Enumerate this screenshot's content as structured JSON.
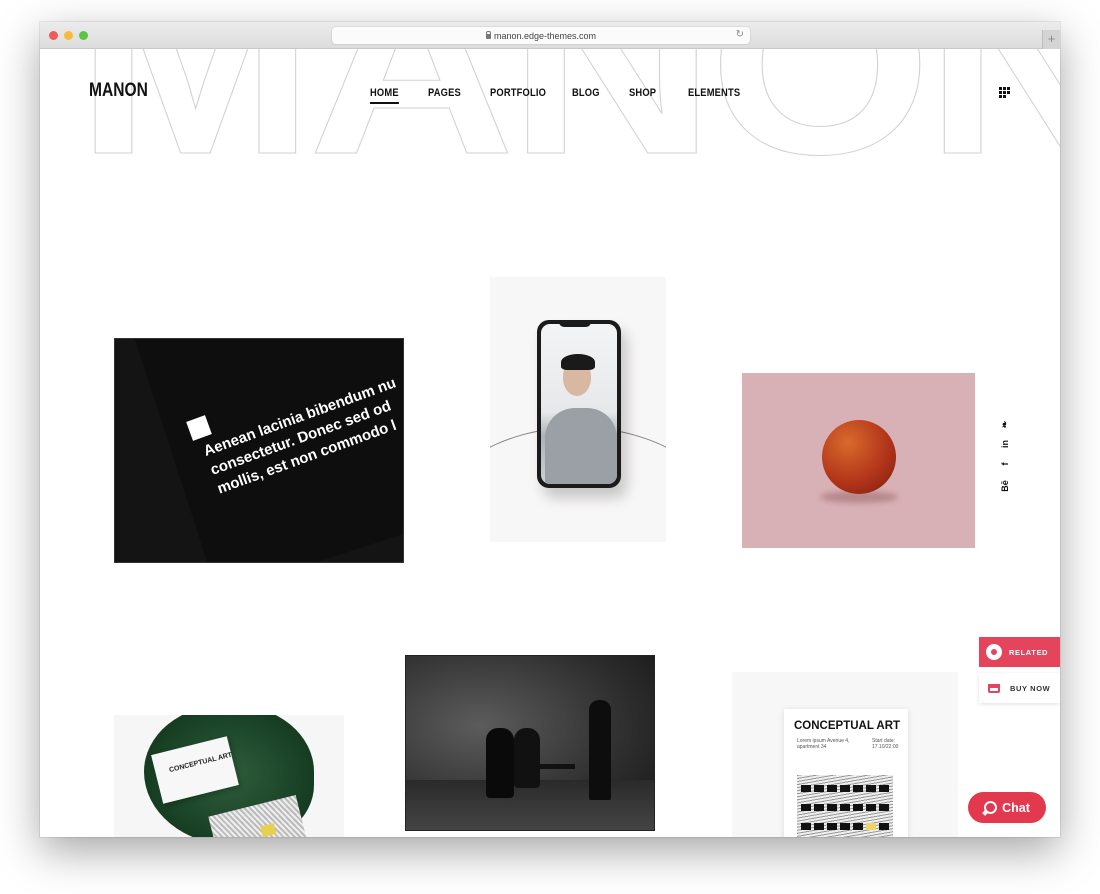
{
  "browser": {
    "url": "manon.edge-themes.com",
    "new_tab_glyph": "+",
    "reload_glyph": "↻"
  },
  "header": {
    "background_word": "MANON",
    "logo": "MANON",
    "nav": [
      {
        "label": "HOME",
        "active": true
      },
      {
        "label": "PAGES",
        "active": false
      },
      {
        "label": "PORTFOLIO",
        "active": false
      },
      {
        "label": "BLOG",
        "active": false
      },
      {
        "label": "SHOP",
        "active": false
      },
      {
        "label": "ELEMENTS",
        "active": false
      }
    ],
    "menu_icon": "grid-dots-icon"
  },
  "portfolio": {
    "items": [
      {
        "name": "typography-card",
        "text": "Aenean lacinia bibendum nu consectetur. Donec sed od mollis, est non commodo l"
      },
      {
        "name": "phone-mockup"
      },
      {
        "name": "peach-photo"
      },
      {
        "name": "business-card-mockup",
        "card_text": "CONCEPTUAL ART"
      },
      {
        "name": "performance-photo"
      },
      {
        "name": "conceptual-art-poster",
        "title": "CONCEPTUAL ART",
        "address": "Lorem ipsum Avenue 4, apartment 34",
        "date": "Start date: 17.10/22:00"
      }
    ]
  },
  "social": [
    {
      "name": "twitter",
      "glyph": "🐦"
    },
    {
      "name": "linkedin",
      "glyph": "in"
    },
    {
      "name": "facebook",
      "glyph": "f"
    },
    {
      "name": "behance",
      "glyph": "Bē"
    }
  ],
  "side_buttons": {
    "related": "RELATED",
    "buy_now": "BUY NOW"
  },
  "chat": {
    "label": "Chat"
  },
  "colors": {
    "accent": "#e4455d",
    "chat": "#e2394f",
    "peach_bg": "#d8b1b6"
  }
}
